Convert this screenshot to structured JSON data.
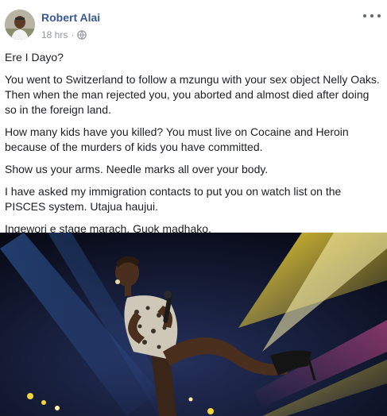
{
  "post": {
    "author": "Robert Alai",
    "time": "18 hrs",
    "separator": "·",
    "privacy_icon": "globe-icon",
    "more_icon": "more-horizontal-icon",
    "paragraphs": [
      "Ere I Dayo?",
      "You went to Switzerland to follow a mzungu with your sex object Nelly Oaks. Then when the man rejected you, you aborted and almost died after doing so in the foreign land.",
      "How many kids have you killed? You must live on Cocaine and Heroin because of the murders of kids you have committed.",
      "Show us your arms. Needle marks all over your body.",
      "I have asked my immigration contacts to put you on watch list on the PISCES system. Utajua haujui.",
      "Ingewori e stage marach. Guok madhako."
    ]
  },
  "colors": {
    "author_link": "#385898",
    "meta_text": "#90949c",
    "body_text": "#1c1e21",
    "stage_background": "#0a0d1f",
    "stage_light_yellow": "#f4d63a",
    "stage_light_blue": "#3f7bd8",
    "stage_light_pink": "#e0529a"
  }
}
